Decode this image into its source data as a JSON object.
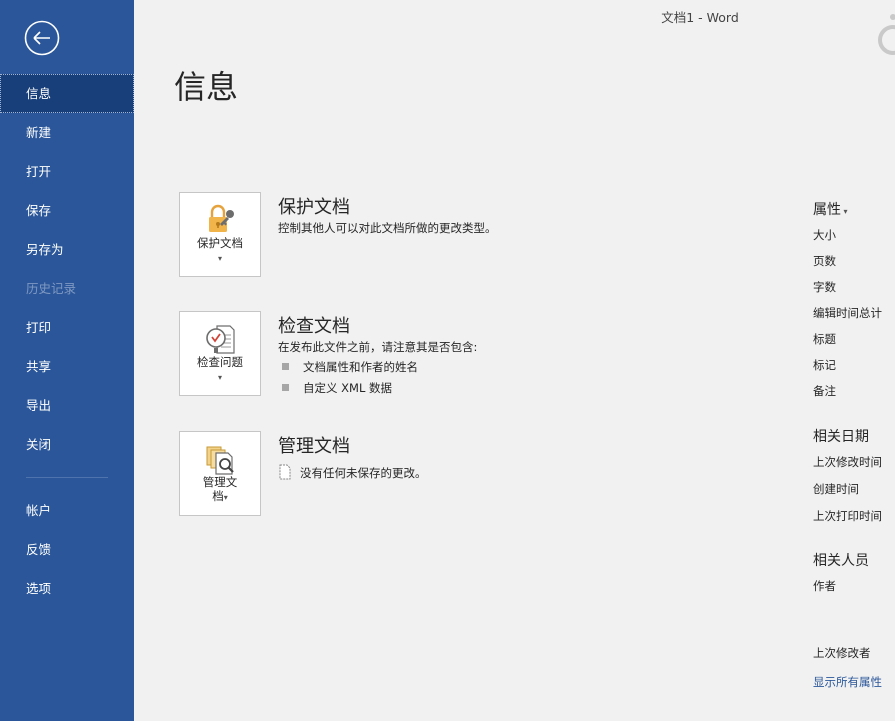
{
  "window": {
    "title": "文档1  -  Word"
  },
  "sidebar": {
    "items": [
      {
        "label": "信息"
      },
      {
        "label": "新建"
      },
      {
        "label": "打开"
      },
      {
        "label": "保存"
      },
      {
        "label": "另存为"
      },
      {
        "label": "历史记录"
      },
      {
        "label": "打印"
      },
      {
        "label": "共享"
      },
      {
        "label": "导出"
      },
      {
        "label": "关闭"
      }
    ],
    "bottom_items": [
      {
        "label": "帐户"
      },
      {
        "label": "反馈"
      },
      {
        "label": "选项"
      }
    ]
  },
  "main": {
    "title": "信息",
    "protect": {
      "button_label": "保护文档",
      "title": "保护文档",
      "desc": "控制其他人可以对此文档所做的更改类型。"
    },
    "inspect": {
      "button_label": "检查问题",
      "title": "检查文档",
      "desc": "在发布此文件之前，请注意其是否包含:",
      "bullets": [
        "文档属性和作者的姓名",
        "自定义 XML 数据"
      ]
    },
    "manage": {
      "button_label_line1": "管理文",
      "button_label_line2": "档",
      "title": "管理文档",
      "desc": "没有任何未保存的更改。"
    }
  },
  "properties": {
    "heading": "属性",
    "items": [
      "大小",
      "页数",
      "字数",
      "编辑时间总计",
      "标题",
      "标记",
      "备注"
    ],
    "dates_heading": "相关日期",
    "dates": [
      "上次修改时间",
      "创建时间",
      "上次打印时间"
    ],
    "people_heading": "相关人员",
    "people": [
      "作者"
    ],
    "last_modified_by": "上次修改者",
    "show_all": "显示所有属性"
  },
  "icons": {
    "back": "back-arrow-icon",
    "protect": "lock-key-icon",
    "inspect": "inspect-checklist-icon",
    "manage": "manage-document-icon",
    "unsaved": "document-icon"
  },
  "colors": {
    "sidebar": "#2b579a",
    "sidebar_active": "#193f7a",
    "link": "#2b579a"
  }
}
